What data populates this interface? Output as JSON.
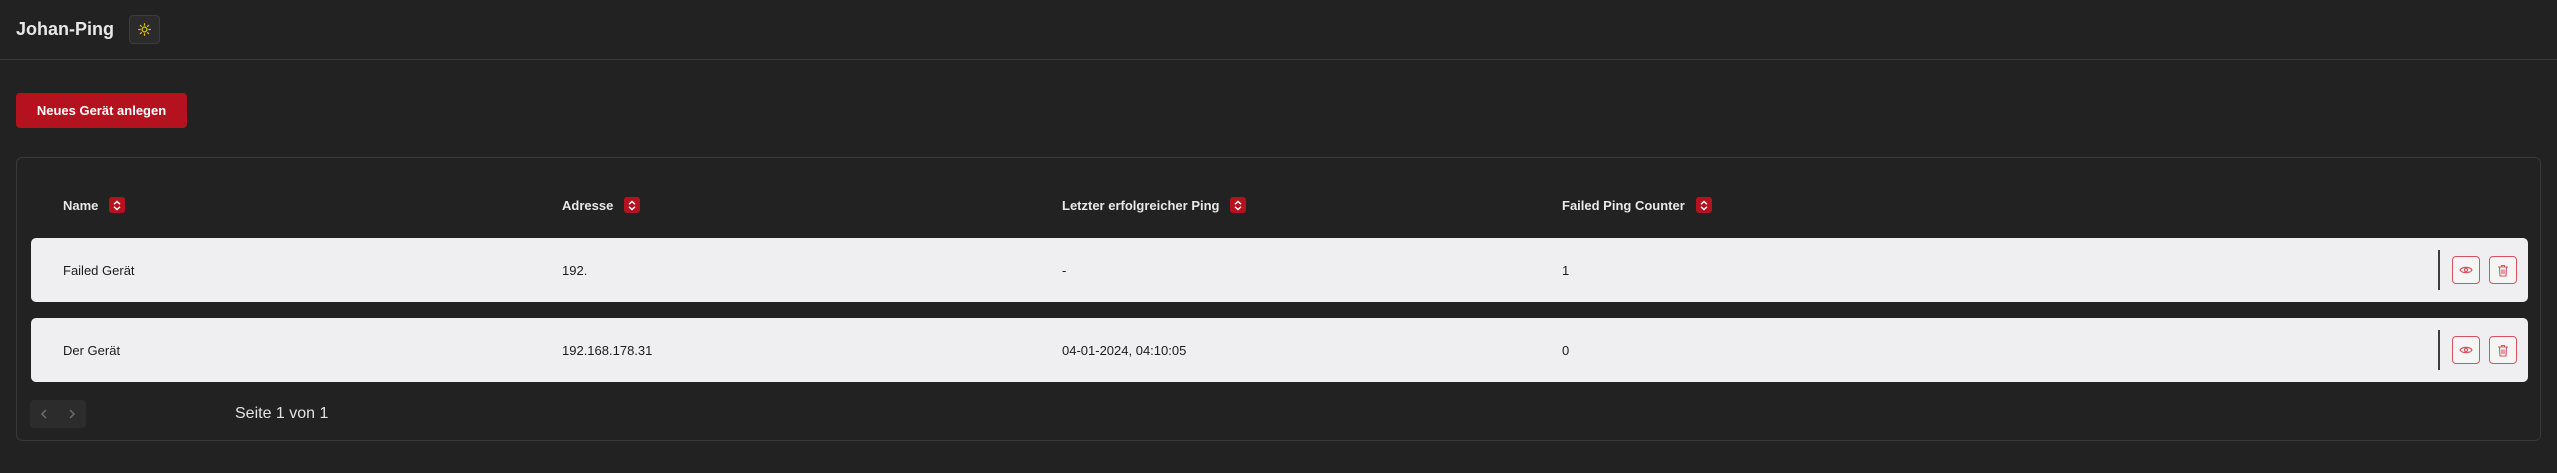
{
  "app": {
    "title": "Johan-Ping"
  },
  "toolbar": {
    "theme_toggle_icon": "sun-icon",
    "new_device_label": "Neues Gerät anlegen"
  },
  "table": {
    "columns": [
      {
        "label": "Name",
        "sort_icon": "sort-icon"
      },
      {
        "label": "Adresse",
        "sort_icon": "sort-icon"
      },
      {
        "label": "Letzter erfolgreicher Ping",
        "sort_icon": "sort-icon"
      },
      {
        "label": "Failed Ping Counter",
        "sort_icon": "sort-icon"
      }
    ],
    "rows": [
      {
        "name": "Failed Gerät",
        "address": "192.",
        "last_ping": "-",
        "failed_count": "1",
        "actions": [
          "eye-icon",
          "trash-icon"
        ]
      },
      {
        "name": "Der Gerät",
        "address": "192.168.178.31",
        "last_ping": "04-01-2024, 04:10:05",
        "failed_count": "0",
        "actions": [
          "eye-icon",
          "trash-icon"
        ]
      }
    ]
  },
  "pagination": {
    "prev_icon": "chevron-left-icon",
    "next_icon": "chevron-right-icon",
    "page_info": "Seite 1 von 1"
  },
  "colors": {
    "accent": "#b5121f",
    "background": "#222222",
    "row_background": "#efeff1",
    "text": "#e6e6e6"
  }
}
